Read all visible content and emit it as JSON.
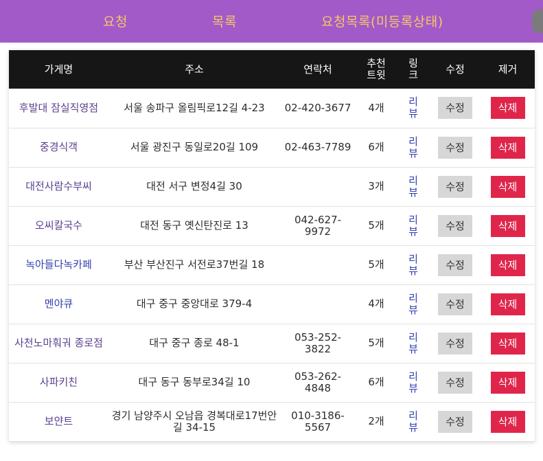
{
  "nav": {
    "items": [
      "요청",
      "목록",
      "요청목록(미등록상태)"
    ]
  },
  "table": {
    "headers": [
      "가게명",
      "주소",
      "연락처",
      "추천트윗",
      "링크",
      "수정",
      "제거"
    ],
    "rows": [
      {
        "name": "후발대 잠실직영점",
        "address": "서울 송파구 올림픽로12길 4-23",
        "phone": "02-420-3677",
        "count": "4개",
        "link": "리뷰",
        "edit": "수정",
        "delete": "삭제"
      },
      {
        "name": "중경식객",
        "address": "서울 광진구 동일로20길 109",
        "phone": "02-463-7789",
        "count": "6개",
        "link": "리뷰",
        "edit": "수정",
        "delete": "삭제"
      },
      {
        "name": "대전사람수부씨",
        "address": "대전 서구 변정4길 30",
        "phone": "",
        "count": "3개",
        "link": "리뷰",
        "edit": "수정",
        "delete": "삭제"
      },
      {
        "name": "오씨칼국수",
        "address": "대전 동구 옛신탄진로 13",
        "phone": "042-627-9972",
        "count": "5개",
        "link": "리뷰",
        "edit": "수정",
        "delete": "삭제"
      },
      {
        "name": "녹아들다녹카페",
        "address": "부산 부산진구 서전로37번길 18",
        "phone": "",
        "count": "5개",
        "link": "리뷰",
        "edit": "수정",
        "delete": "삭제"
      },
      {
        "name": "멘야큐",
        "address": "대구 중구 중앙대로 379-4",
        "phone": "",
        "count": "4개",
        "link": "리뷰",
        "edit": "수정",
        "delete": "삭제"
      },
      {
        "name": "사천노마훠궈 종로점",
        "address": "대구 중구 종로 48-1",
        "phone": "053-252-3822",
        "count": "5개",
        "link": "리뷰",
        "edit": "수정",
        "delete": "삭제"
      },
      {
        "name": "사파키친",
        "address": "대구 동구 동부로34길 10",
        "phone": "053-262-4848",
        "count": "6개",
        "link": "리뷰",
        "edit": "수정",
        "delete": "삭제"
      },
      {
        "name": "보얀트",
        "address": "경기 남양주시 오남읍 경복대로17번안길 34-15",
        "phone": "010-3186-5567",
        "count": "2개",
        "link": "리뷰",
        "edit": "수정",
        "delete": "삭제"
      }
    ]
  },
  "colors": {
    "topbar": "#a35ac9",
    "nav_text": "#f6c766",
    "header_bg": "#161616",
    "edit_button": "#d7d7d7",
    "delete_button": "#e0254b",
    "link_text": "#3340b0"
  }
}
